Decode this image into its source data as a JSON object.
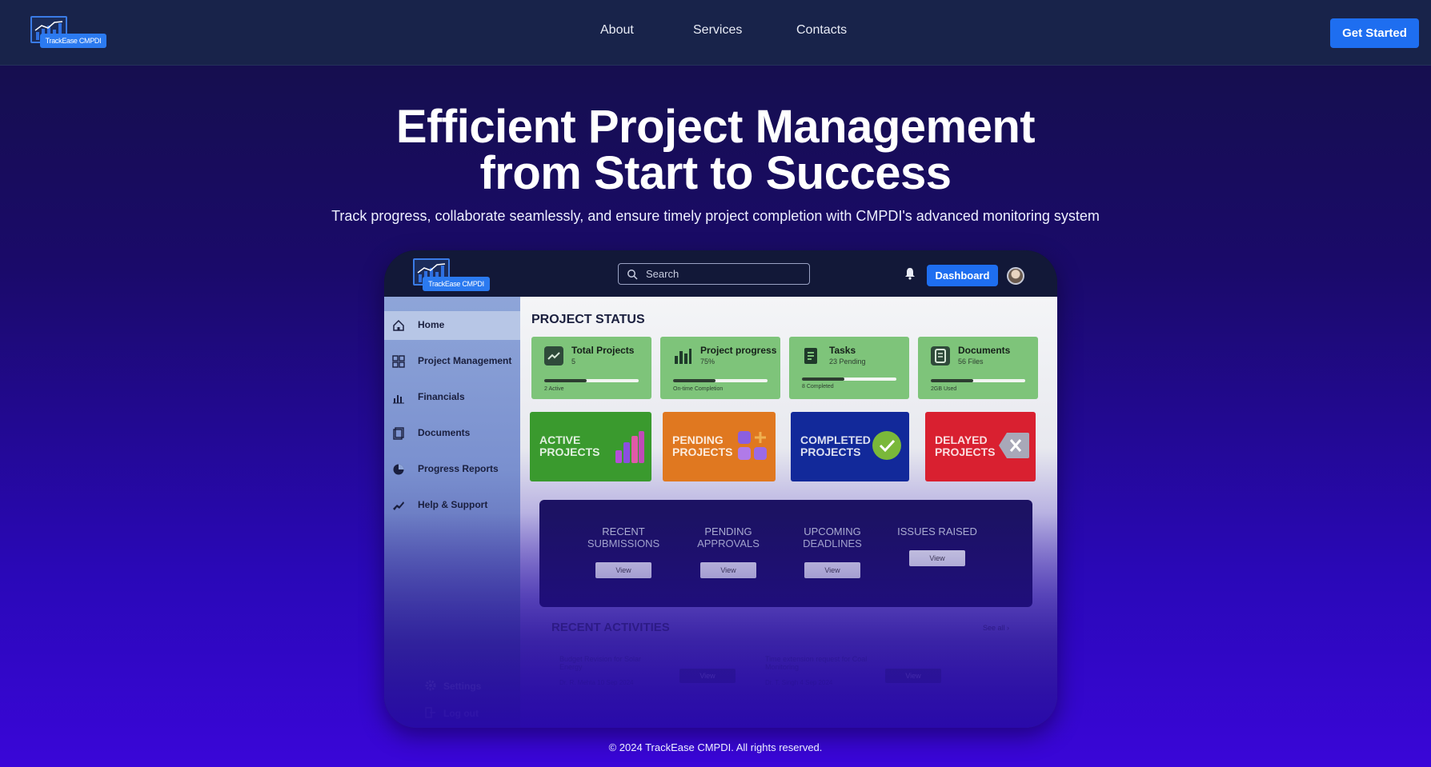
{
  "brand": {
    "name": "TrackEase CMPDI"
  },
  "nav": {
    "links": [
      "About",
      "Services",
      "Contacts"
    ],
    "cta": "Get Started"
  },
  "hero": {
    "title_line1": "Efficient Project Management",
    "title_line2": "from Start to Success",
    "subtitle": "Track progress, collaborate seamlessly, and ensure timely project completion with CMPDI's advanced monitoring system"
  },
  "mockup": {
    "logo_text": "TrackEase CMPDI",
    "search_placeholder": "Search",
    "dashboard_button": "Dashboard",
    "sidebar": {
      "items": [
        "Home",
        "Project Management",
        "Financials",
        "Documents",
        "Progress Reports",
        "Help & Support"
      ],
      "bottom": [
        "Settings",
        "Log out"
      ]
    },
    "section_title": "PROJECT STATUS",
    "stats": [
      {
        "name": "Total Projects",
        "value": "5",
        "foot": "2 Active",
        "progress": 0.45
      },
      {
        "name": "Project progress",
        "value": "75%",
        "foot": "On-time Completion",
        "progress": 0.45
      },
      {
        "name": "Tasks",
        "value": "23 Pending",
        "foot": "8 Completed",
        "progress": 0.45
      },
      {
        "name": "Documents",
        "value": "56 Files",
        "foot": "2GB Used",
        "progress": 0.45
      }
    ],
    "tiles": [
      {
        "label": "ACTIVE PROJECTS",
        "color": "#3a9a2e"
      },
      {
        "label": "PENDING PROJECTS",
        "color": "#e07820"
      },
      {
        "label": "COMPLETED PROJECTS",
        "color": "#12299a"
      },
      {
        "label": "DELAYED PROJECTS",
        "color": "#d92030"
      }
    ],
    "panel": [
      {
        "label": "RECENT SUBMISSIONS",
        "button": "View"
      },
      {
        "label": "PENDING APPROVALS",
        "button": "View"
      },
      {
        "label": "UPCOMING DEADLINES",
        "button": "View"
      },
      {
        "label": "ISSUES RAISED",
        "button": "View"
      }
    ],
    "recent_title": "RECENT ACTIVITIES",
    "see_all": "See all",
    "activities": [
      {
        "title": "Budget Revision for Solar Energy",
        "meta": "Dr. R. Mehta  10 Sep 2024",
        "button": "View"
      },
      {
        "title": "Time extension request for Coal Monitoring",
        "meta": "Dr. T. Singh  4 Sep 2024",
        "button": "View"
      }
    ]
  },
  "footer": {
    "text": "© 2024 TrackEase CMPDI. All rights reserved."
  }
}
